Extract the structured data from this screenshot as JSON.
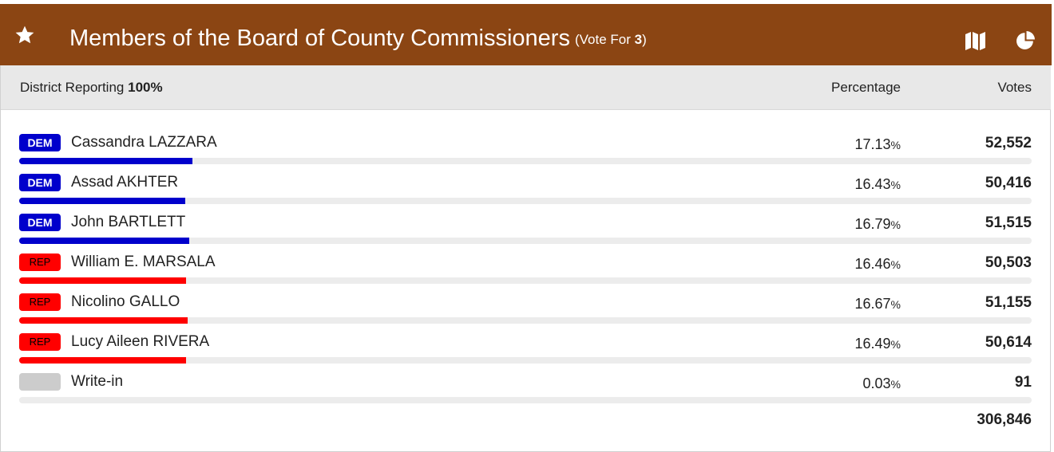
{
  "header": {
    "title": "Members of the Board of County Commissioners",
    "vote_for_prefix": "(Vote For ",
    "vote_for_count": "3",
    "vote_for_suffix": ")",
    "background_color": "#8b4513",
    "icons": [
      "star-icon",
      "map-icon",
      "pie-chart-icon"
    ]
  },
  "subheader": {
    "reporting_label": "District Reporting",
    "reporting_value": "100%",
    "percentage_header": "Percentage",
    "votes_header": "Votes"
  },
  "party_colors": {
    "DEM": "#0000cc",
    "REP": "#ff0000",
    "NONE": "#cccccc"
  },
  "candidates": [
    {
      "party": "DEM",
      "name": "Cassandra LAZZARA",
      "percent_value": "17.13",
      "percent_unit": "%",
      "share": 0.1713,
      "votes": "52,552"
    },
    {
      "party": "DEM",
      "name": "Assad AKHTER",
      "percent_value": "16.43",
      "percent_unit": "%",
      "share": 0.1643,
      "votes": "50,416"
    },
    {
      "party": "DEM",
      "name": "John BARTLETT",
      "percent_value": "16.79",
      "percent_unit": "%",
      "share": 0.1679,
      "votes": "51,515"
    },
    {
      "party": "REP",
      "name": "William E. MARSALA",
      "percent_value": "16.46",
      "percent_unit": "%",
      "share": 0.1646,
      "votes": "50,503"
    },
    {
      "party": "REP",
      "name": "Nicolino GALLO",
      "percent_value": "16.67",
      "percent_unit": "%",
      "share": 0.1667,
      "votes": "51,155"
    },
    {
      "party": "REP",
      "name": "Lucy Aileen RIVERA",
      "percent_value": "16.49",
      "percent_unit": "%",
      "share": 0.1649,
      "votes": "50,614"
    },
    {
      "party": "NONE",
      "name": "Write-in",
      "percent_value": "0.03",
      "percent_unit": "%",
      "share": 0.0003,
      "votes": "91"
    }
  ],
  "total_votes": "306,846"
}
